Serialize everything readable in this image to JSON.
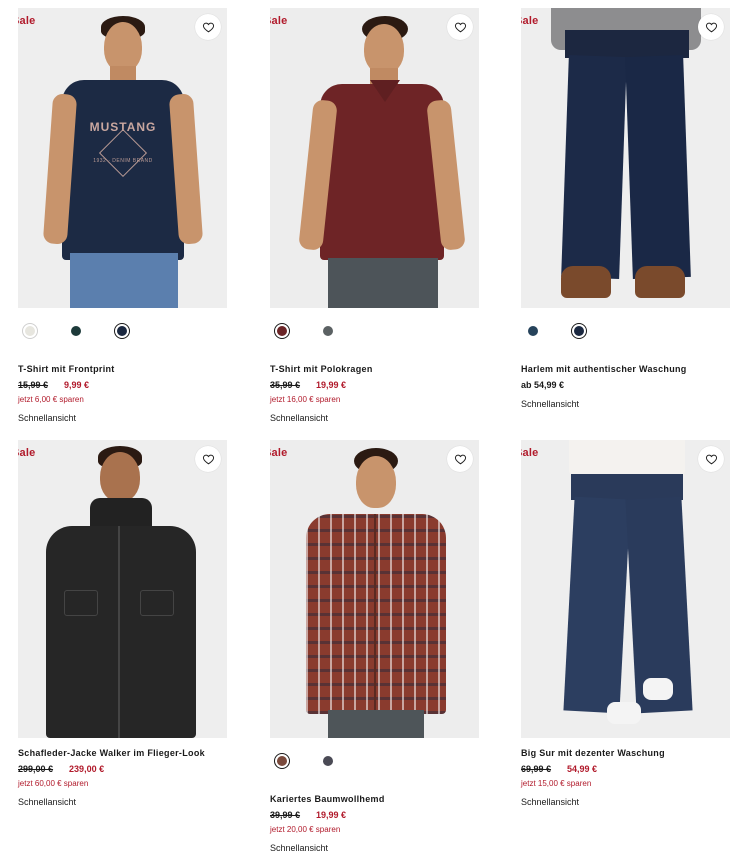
{
  "products": [
    {
      "sale_badge": "Sale",
      "title": "T-Shirt mit Frontprint",
      "old_price": "15,99 €",
      "new_price": "9,99 €",
      "savings": "jetzt 6,00 € sparen",
      "quick_view": "Schnellansicht",
      "colors": [
        "#e7e6df",
        "#1d3a3a",
        "#1b2840"
      ],
      "active_color": 2
    },
    {
      "sale_badge": "Sale",
      "title": "T-Shirt mit Polokragen",
      "old_price": "35,99 €",
      "new_price": "19,99 €",
      "savings": "jetzt 16,00 € sparen",
      "quick_view": "Schnellansicht",
      "colors": [
        "#6b2527",
        "#5b6163"
      ],
      "active_color": 0
    },
    {
      "sale_badge": "Sale",
      "title": "Harlem mit authentischer Waschung",
      "price_from": "ab 54,99 €",
      "quick_view": "Schnellansicht",
      "colors": [
        "#26435b",
        "#1b2840"
      ],
      "active_color": 1
    },
    {
      "sale_badge": "Sale",
      "title": "Schafleder-Jacke Walker im Flieger-Look",
      "old_price": "299,00 €",
      "new_price": "239,00 €",
      "savings": "jetzt 60,00 € sparen",
      "quick_view": "Schnellansicht"
    },
    {
      "sale_badge": "Sale",
      "title": "Kariertes Baumwollhemd",
      "old_price": "39,99 €",
      "new_price": "19,99 €",
      "savings": "jetzt 20,00 € sparen",
      "quick_view": "Schnellansicht",
      "colors": [
        "#7a4a3c",
        "#4a4a55"
      ],
      "active_color": 0
    },
    {
      "sale_badge": "Sale",
      "title": "Big Sur mit dezenter Waschung",
      "old_price": "69,99 €",
      "new_price": "54,99 €",
      "savings": "jetzt 15,00 € sparen",
      "quick_view": "Schnellansicht"
    }
  ],
  "icons": {
    "wishlist": "heart-outline-icon"
  },
  "accent_color": "#b11a2b"
}
